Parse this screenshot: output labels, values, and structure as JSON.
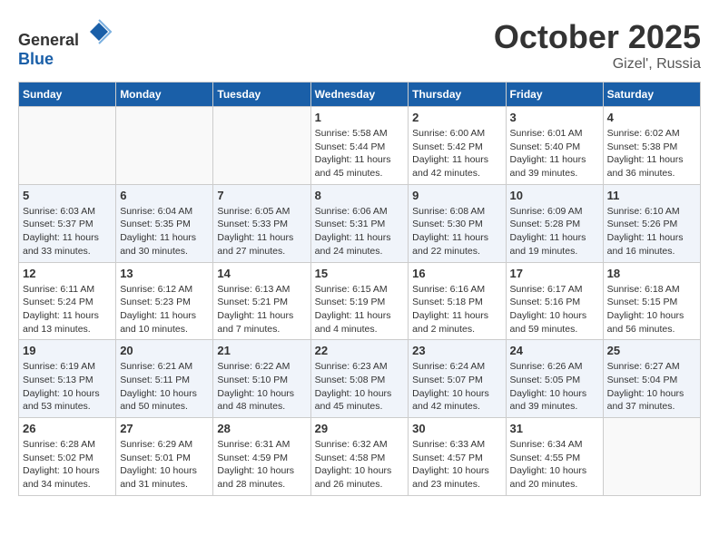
{
  "header": {
    "logo_general": "General",
    "logo_blue": "Blue",
    "month": "October 2025",
    "location": "Gizel', Russia"
  },
  "weekdays": [
    "Sunday",
    "Monday",
    "Tuesday",
    "Wednesday",
    "Thursday",
    "Friday",
    "Saturday"
  ],
  "weeks": [
    [
      {
        "day": "",
        "info": ""
      },
      {
        "day": "",
        "info": ""
      },
      {
        "day": "",
        "info": ""
      },
      {
        "day": "1",
        "info": "Sunrise: 5:58 AM\nSunset: 5:44 PM\nDaylight: 11 hours and 45 minutes."
      },
      {
        "day": "2",
        "info": "Sunrise: 6:00 AM\nSunset: 5:42 PM\nDaylight: 11 hours and 42 minutes."
      },
      {
        "day": "3",
        "info": "Sunrise: 6:01 AM\nSunset: 5:40 PM\nDaylight: 11 hours and 39 minutes."
      },
      {
        "day": "4",
        "info": "Sunrise: 6:02 AM\nSunset: 5:38 PM\nDaylight: 11 hours and 36 minutes."
      }
    ],
    [
      {
        "day": "5",
        "info": "Sunrise: 6:03 AM\nSunset: 5:37 PM\nDaylight: 11 hours and 33 minutes."
      },
      {
        "day": "6",
        "info": "Sunrise: 6:04 AM\nSunset: 5:35 PM\nDaylight: 11 hours and 30 minutes."
      },
      {
        "day": "7",
        "info": "Sunrise: 6:05 AM\nSunset: 5:33 PM\nDaylight: 11 hours and 27 minutes."
      },
      {
        "day": "8",
        "info": "Sunrise: 6:06 AM\nSunset: 5:31 PM\nDaylight: 11 hours and 24 minutes."
      },
      {
        "day": "9",
        "info": "Sunrise: 6:08 AM\nSunset: 5:30 PM\nDaylight: 11 hours and 22 minutes."
      },
      {
        "day": "10",
        "info": "Sunrise: 6:09 AM\nSunset: 5:28 PM\nDaylight: 11 hours and 19 minutes."
      },
      {
        "day": "11",
        "info": "Sunrise: 6:10 AM\nSunset: 5:26 PM\nDaylight: 11 hours and 16 minutes."
      }
    ],
    [
      {
        "day": "12",
        "info": "Sunrise: 6:11 AM\nSunset: 5:24 PM\nDaylight: 11 hours and 13 minutes."
      },
      {
        "day": "13",
        "info": "Sunrise: 6:12 AM\nSunset: 5:23 PM\nDaylight: 11 hours and 10 minutes."
      },
      {
        "day": "14",
        "info": "Sunrise: 6:13 AM\nSunset: 5:21 PM\nDaylight: 11 hours and 7 minutes."
      },
      {
        "day": "15",
        "info": "Sunrise: 6:15 AM\nSunset: 5:19 PM\nDaylight: 11 hours and 4 minutes."
      },
      {
        "day": "16",
        "info": "Sunrise: 6:16 AM\nSunset: 5:18 PM\nDaylight: 11 hours and 2 minutes."
      },
      {
        "day": "17",
        "info": "Sunrise: 6:17 AM\nSunset: 5:16 PM\nDaylight: 10 hours and 59 minutes."
      },
      {
        "day": "18",
        "info": "Sunrise: 6:18 AM\nSunset: 5:15 PM\nDaylight: 10 hours and 56 minutes."
      }
    ],
    [
      {
        "day": "19",
        "info": "Sunrise: 6:19 AM\nSunset: 5:13 PM\nDaylight: 10 hours and 53 minutes."
      },
      {
        "day": "20",
        "info": "Sunrise: 6:21 AM\nSunset: 5:11 PM\nDaylight: 10 hours and 50 minutes."
      },
      {
        "day": "21",
        "info": "Sunrise: 6:22 AM\nSunset: 5:10 PM\nDaylight: 10 hours and 48 minutes."
      },
      {
        "day": "22",
        "info": "Sunrise: 6:23 AM\nSunset: 5:08 PM\nDaylight: 10 hours and 45 minutes."
      },
      {
        "day": "23",
        "info": "Sunrise: 6:24 AM\nSunset: 5:07 PM\nDaylight: 10 hours and 42 minutes."
      },
      {
        "day": "24",
        "info": "Sunrise: 6:26 AM\nSunset: 5:05 PM\nDaylight: 10 hours and 39 minutes."
      },
      {
        "day": "25",
        "info": "Sunrise: 6:27 AM\nSunset: 5:04 PM\nDaylight: 10 hours and 37 minutes."
      }
    ],
    [
      {
        "day": "26",
        "info": "Sunrise: 6:28 AM\nSunset: 5:02 PM\nDaylight: 10 hours and 34 minutes."
      },
      {
        "day": "27",
        "info": "Sunrise: 6:29 AM\nSunset: 5:01 PM\nDaylight: 10 hours and 31 minutes."
      },
      {
        "day": "28",
        "info": "Sunrise: 6:31 AM\nSunset: 4:59 PM\nDaylight: 10 hours and 28 minutes."
      },
      {
        "day": "29",
        "info": "Sunrise: 6:32 AM\nSunset: 4:58 PM\nDaylight: 10 hours and 26 minutes."
      },
      {
        "day": "30",
        "info": "Sunrise: 6:33 AM\nSunset: 4:57 PM\nDaylight: 10 hours and 23 minutes."
      },
      {
        "day": "31",
        "info": "Sunrise: 6:34 AM\nSunset: 4:55 PM\nDaylight: 10 hours and 20 minutes."
      },
      {
        "day": "",
        "info": ""
      }
    ]
  ]
}
